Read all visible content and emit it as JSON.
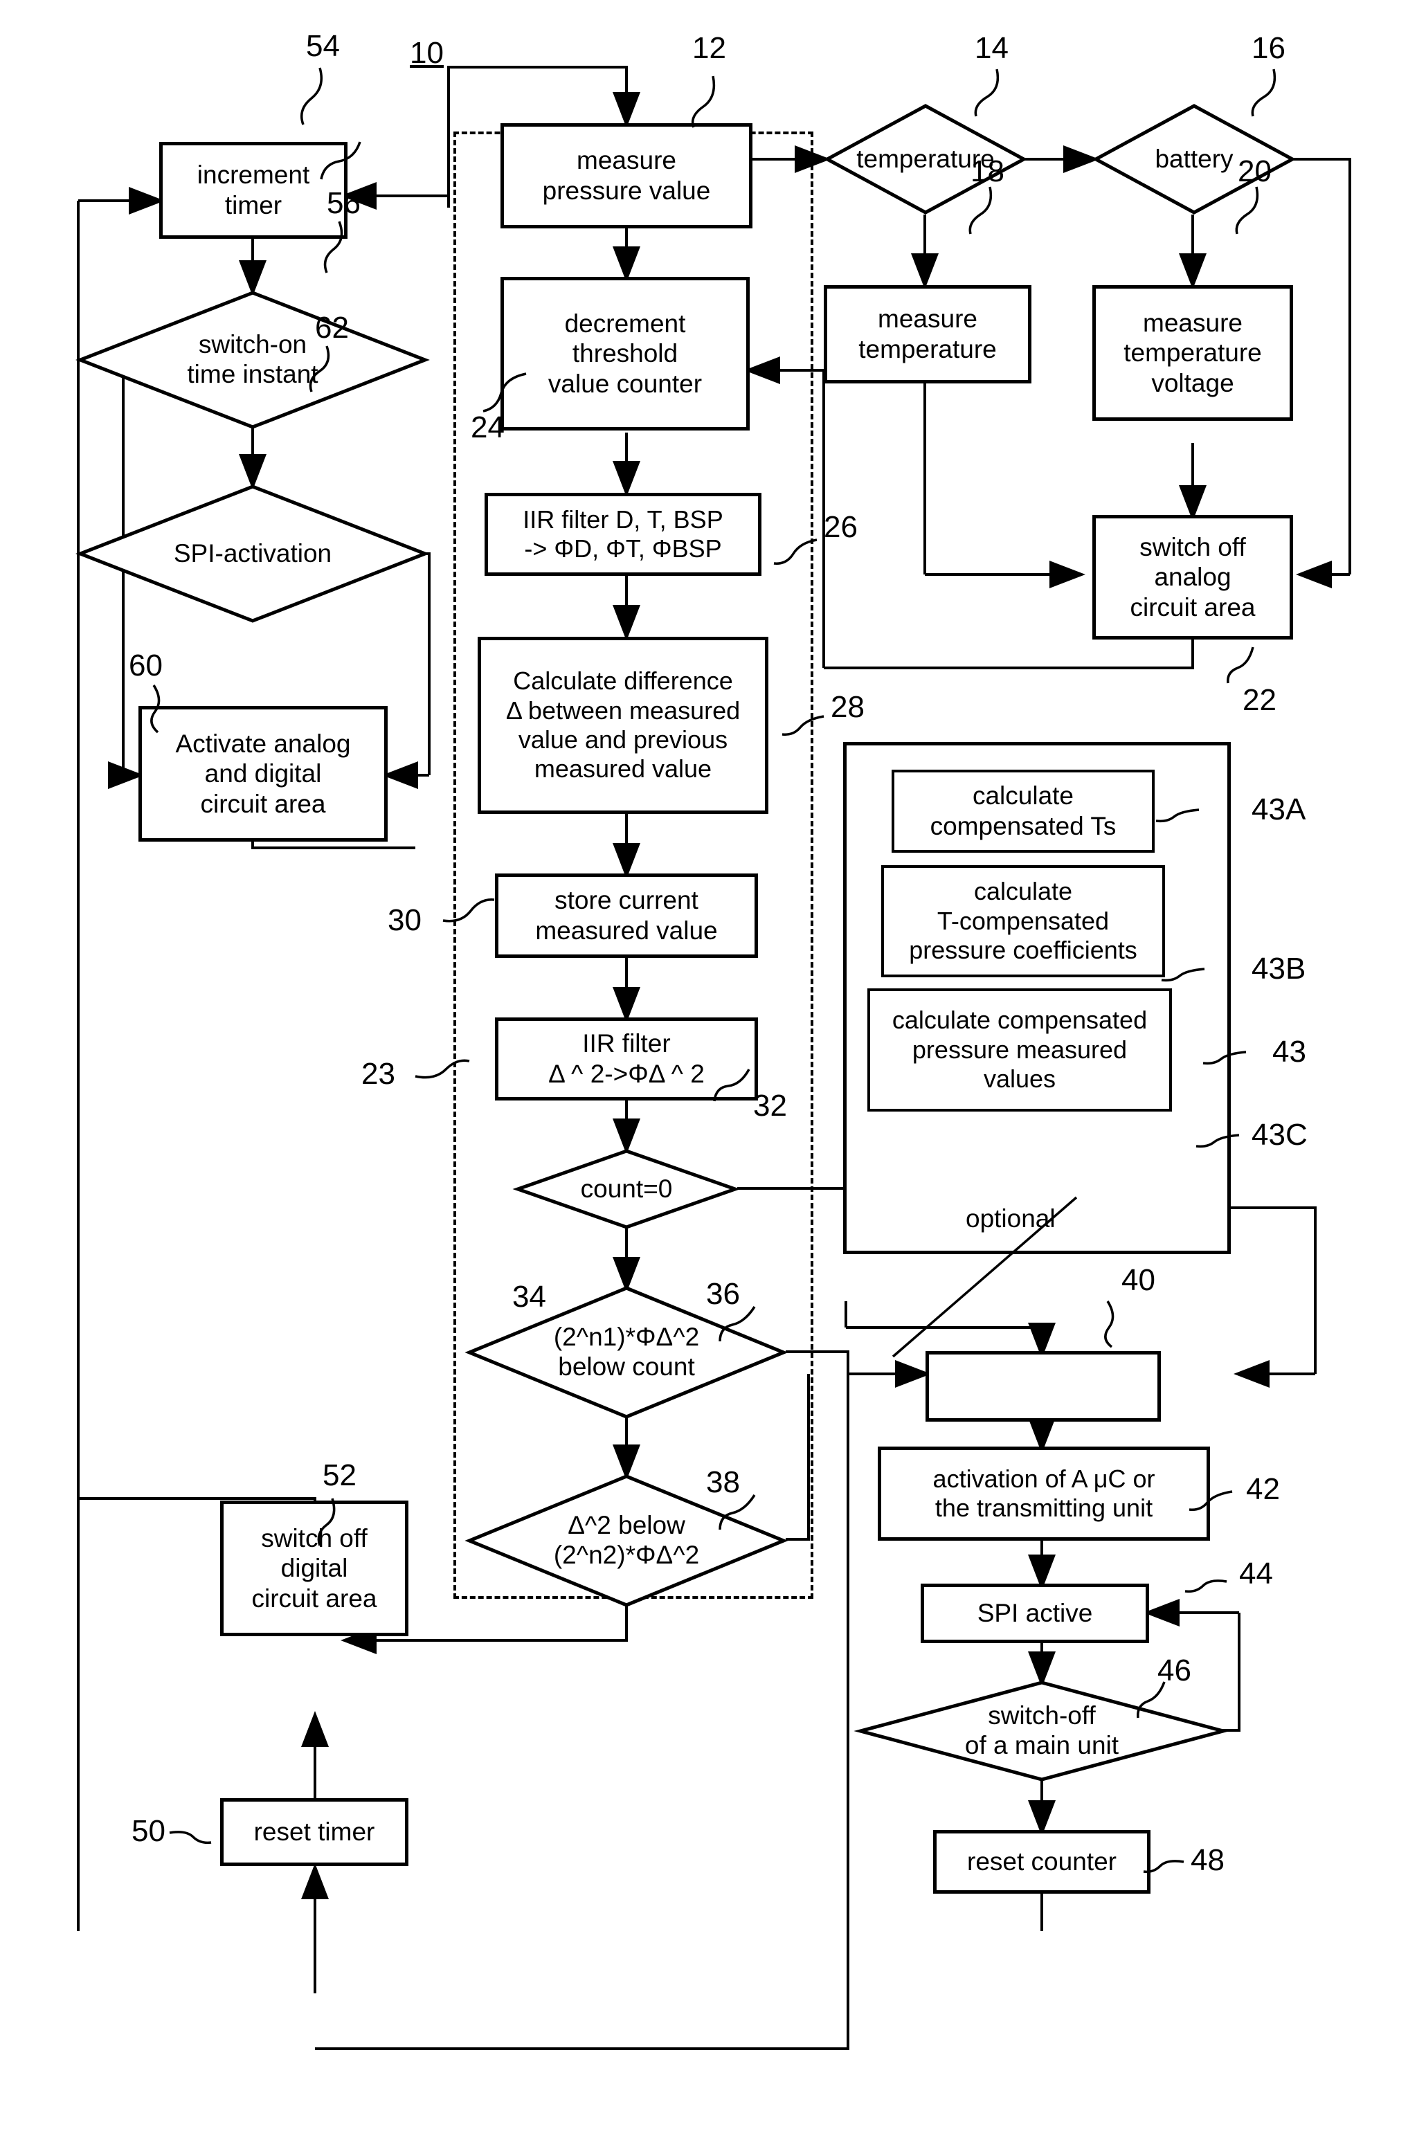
{
  "figure": {
    "id_label": "10",
    "optional_label": "optional"
  },
  "nodes": {
    "n12": {
      "ref": "12",
      "text": "measure\npressure value"
    },
    "n14": {
      "ref": "14",
      "text": "temperature"
    },
    "n16": {
      "ref": "16",
      "text": "battery"
    },
    "n18": {
      "ref": "18",
      "text": "measure\ntemperature"
    },
    "n20": {
      "ref": "20",
      "text": "measure\ntemperature\nvoltage"
    },
    "n22": {
      "ref": "22",
      "text": "switch off\nanalog\ncircuit area"
    },
    "n23": {
      "ref": "23",
      "text": ""
    },
    "n24": {
      "ref": "24",
      "text": "decrement\nthreshold\nvalue counter"
    },
    "n26": {
      "ref": "26",
      "text": "IIR filter D, T, BSP\n-> ΦD, ΦT, ΦBSP"
    },
    "n28": {
      "ref": "28",
      "text": "Calculate difference\nΔ between measured\nvalue and previous\nmeasured value"
    },
    "n30": {
      "ref": "30",
      "text": "store current\nmeasured value"
    },
    "n32": {
      "ref": "32",
      "text": "IIR filter\nΔ ^ 2->ΦΔ ^ 2"
    },
    "n34": {
      "ref": "34",
      "text": "count=0"
    },
    "n36": {
      "ref": "36",
      "text": "(2^n1)*ΦΔ^2\nbelow count"
    },
    "n38": {
      "ref": "38",
      "text": "Δ^2 below\n(2^n2)*ΦΔ^2"
    },
    "n40": {
      "ref": "40",
      "text": ""
    },
    "n42": {
      "ref": "42",
      "text": "activation of A μC or\nthe transmitting unit"
    },
    "n43": {
      "ref": "43",
      "text": ""
    },
    "n43A": {
      "ref": "43A",
      "text": "calculate\ncompensated Ts"
    },
    "n43B": {
      "ref": "43B",
      "text": "calculate\nT-compensated\npressure coefficients"
    },
    "n43C": {
      "ref": "43C",
      "text": "calculate compensated\npressure measured\nvalues"
    },
    "n44": {
      "ref": "44",
      "text": "SPI active"
    },
    "n46": {
      "ref": "46",
      "text": "switch-off\nof a main unit"
    },
    "n48": {
      "ref": "48",
      "text": "reset counter"
    },
    "n50": {
      "ref": "50",
      "text": "reset timer"
    },
    "n52": {
      "ref": "52",
      "text": "switch off\ndigital\ncircuit area"
    },
    "n54": {
      "ref": "54",
      "text": "increment\ntimer"
    },
    "n56": {
      "ref": "56",
      "text": "switch-on\ntime instant"
    },
    "n60": {
      "ref": "60",
      "text": "Activate analog\nand digital\ncircuit area"
    },
    "n62": {
      "ref": "62",
      "text": "SPI-activation"
    }
  },
  "colors": {
    "stroke": "#000000",
    "background": "#ffffff"
  }
}
